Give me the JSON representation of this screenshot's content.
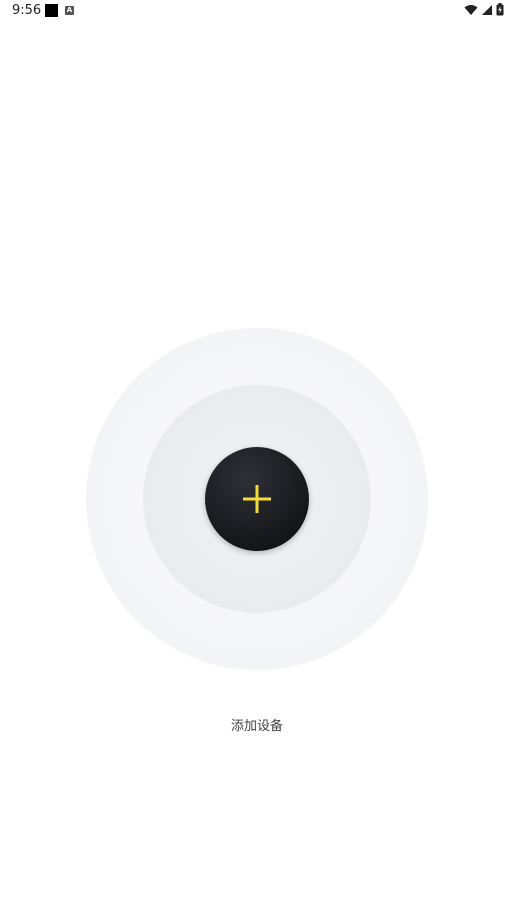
{
  "status_bar": {
    "time": "9:56",
    "notif_icons": [
      "black-square-icon",
      "a-app-icon"
    ],
    "notif_a_letter": "A",
    "system_icons": [
      "wifi-icon",
      "signal-icon",
      "battery-charging-icon"
    ]
  },
  "main": {
    "add_label": "添加设备",
    "plus_icon": "plus-icon",
    "accent_color": "#f5dc3a",
    "button_color": "#1b1c20"
  }
}
